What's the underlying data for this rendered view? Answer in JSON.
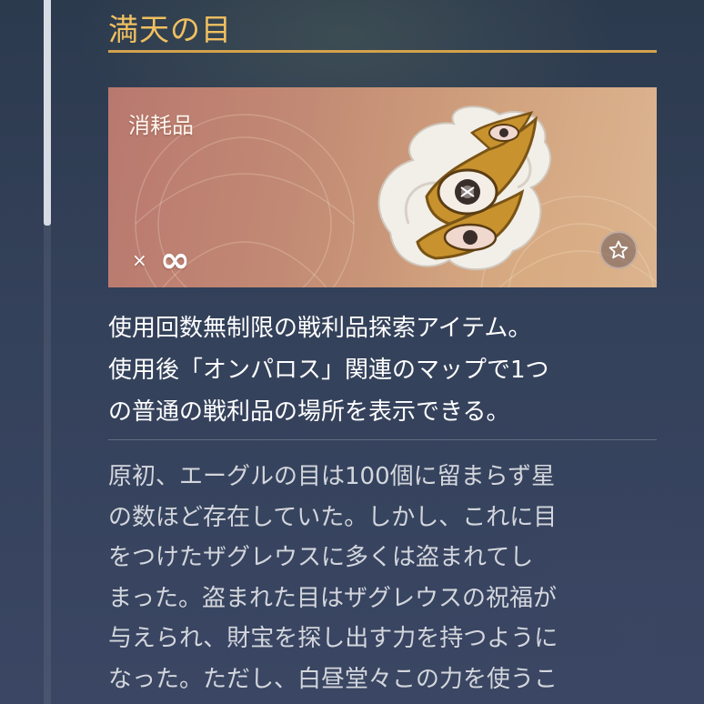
{
  "item": {
    "name": "満天の目",
    "category": "消耗品",
    "quantity_prefix": "×",
    "quantity": "∞"
  },
  "icons": {
    "item_art": "golden-eye-artifact",
    "favorite": "star-icon"
  },
  "description": [
    "使用回数無制限の戦利品探索アイテム。",
    "使用後「オンパロス」関連のマップで1つ",
    "の普通の戦利品の場所を表示できる。"
  ],
  "lore": [
    "原初、エーグルの目は100個に留まらず星",
    "の数ほど存在していた。しかし、これに目",
    "をつけたザグレウスに多くは盗まれてし",
    "まった。盗まれた目はザグレウスの祝福が",
    "与えられ、財宝を探し出す力を持つように",
    "なった。ただし、白昼堂々この力を使うこ"
  ],
  "colors": {
    "title": "#f0c060",
    "accent_rule": "#d4a24c",
    "card_start": "#b9786f",
    "card_end": "#dcb590"
  }
}
